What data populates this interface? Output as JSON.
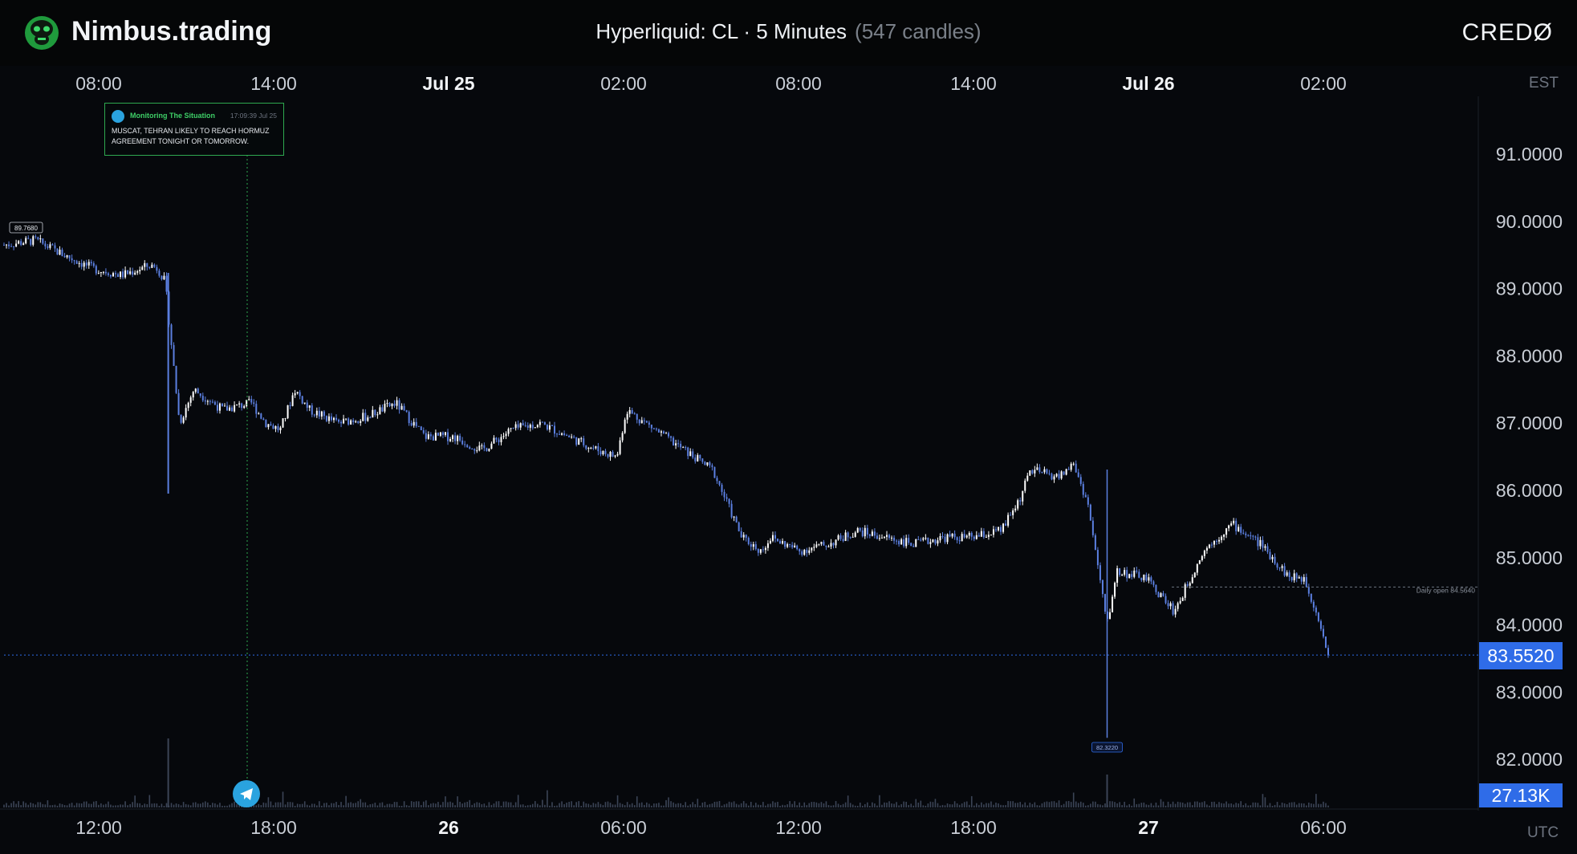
{
  "header": {
    "brand": "Nimbus.trading",
    "title": "Hyperliquid: CL · 5 Minutes",
    "candle_count": "(547 candles)",
    "partner_logo": "CREDØ",
    "brand_icon": "gorilla-logo-icon"
  },
  "axis": {
    "top_timezone": "EST",
    "bottom_timezone": "UTC",
    "top_ticks": [
      "08:00",
      "14:00",
      "Jul 25",
      "02:00",
      "08:00",
      "14:00",
      "Jul 26",
      "02:00"
    ],
    "bottom_ticks": [
      "12:00",
      "18:00",
      "26",
      "06:00",
      "12:00",
      "18:00",
      "27",
      "06:00"
    ],
    "price_ticks": [
      "91.0000",
      "90.0000",
      "89.0000",
      "88.0000",
      "87.0000",
      "86.0000",
      "85.0000",
      "84.0000",
      "83.0000",
      "82.0000"
    ]
  },
  "labels": {
    "current_price": "83.5520",
    "volume": "27.13K",
    "start_price": "89.7680",
    "low_price": "82.3220",
    "daily_open": "Daily open 84.5640"
  },
  "news": {
    "source": "Monitoring The Situation",
    "timestamp": "17:09:39 Jul 25",
    "message": "MUSCAT, TEHRAN LIKELY TO REACH HORMUZ AGREEMENT TONIGHT OR TOMORROW.",
    "icon": "telegram-icon"
  },
  "colors": {
    "background": "#06080c",
    "candle_up": "#ffffff",
    "candle_down": "#5b7fe0",
    "accent": "#2f6ce8",
    "news_border": "#2ea84f",
    "telegram": "#2aa3df"
  },
  "chart_data": {
    "type": "line",
    "title": "Hyperliquid: CL · 5 Minutes",
    "x_label_timezone_top": "EST",
    "x_label_timezone_bottom": "UTC",
    "ylim": [
      81.3,
      92.0
    ],
    "y_ticks": [
      91,
      90,
      89,
      88,
      87,
      86,
      85,
      84,
      83,
      82
    ],
    "series": [
      {
        "x_utc": [
          "Jul 25 08:25",
          "Jul 25 09:30",
          "Jul 25 10:30",
          "Jul 25 11:30",
          "Jul 25 12:30",
          "Jul 25 13:30",
          "Jul 25 13:45",
          "Jul 25 14:00",
          "Jul 25 14:30",
          "Jul 25 15:00",
          "Jul 25 16:00",
          "Jul 25 17:00",
          "Jul 25 17:30",
          "Jul 25 18:00",
          "Jul 25 18:30",
          "Jul 25 19:00",
          "Jul 25 20:00",
          "Jul 25 21:00",
          "Jul 25 22:00",
          "Jul 25 23:00",
          "Jul 26 00:00",
          "Jul 26 01:00",
          "Jul 26 02:00",
          "Jul 26 03:00",
          "Jul 26 04:00",
          "Jul 26 05:00",
          "Jul 26 05:40",
          "Jul 26 06:00",
          "Jul 26 07:00",
          "Jul 26 08:00",
          "Jul 26 09:00",
          "Jul 26 10:00",
          "Jul 26 10:40",
          "Jul 26 11:00",
          "Jul 26 12:00",
          "Jul 26 13:00",
          "Jul 26 14:00",
          "Jul 26 15:00",
          "Jul 26 16:00",
          "Jul 26 17:00",
          "Jul 26 18:00",
          "Jul 26 19:00",
          "Jul 26 19:40",
          "Jul 26 20:00",
          "Jul 26 21:00",
          "Jul 26 21:30",
          "Jul 26 22:00",
          "Jul 26 22:40",
          "Jul 26 23:00",
          "Jul 27 00:00",
          "Jul 27 01:00",
          "Jul 27 02:00",
          "Jul 27 03:00",
          "Jul 27 04:00",
          "Jul 27 05:00",
          "Jul 27 05:30",
          "Jul 27 06:00",
          "Jul 27 06:20"
        ],
        "close": [
          89.65,
          89.72,
          89.5,
          89.3,
          89.2,
          89.35,
          89.3,
          89.1,
          87.0,
          87.5,
          87.2,
          87.3,
          87.0,
          86.9,
          87.5,
          87.2,
          87.0,
          87.1,
          87.3,
          86.8,
          86.8,
          86.6,
          86.9,
          87.0,
          86.8,
          86.6,
          86.5,
          87.2,
          86.9,
          86.6,
          86.3,
          85.3,
          85.1,
          85.3,
          85.1,
          85.2,
          85.4,
          85.3,
          85.2,
          85.3,
          85.3,
          85.4,
          85.9,
          86.3,
          86.2,
          86.4,
          85.8,
          84.0,
          84.8,
          84.7,
          84.2,
          85.1,
          85.5,
          85.2,
          84.7,
          84.7,
          84.1,
          83.55
        ]
      }
    ],
    "annotations": {
      "start_price": 89.768,
      "low": 82.322,
      "daily_open": 84.564,
      "current_price": 83.552,
      "current_volume": "27.13K",
      "news_time_utc": "Jul 25 17:09"
    }
  }
}
